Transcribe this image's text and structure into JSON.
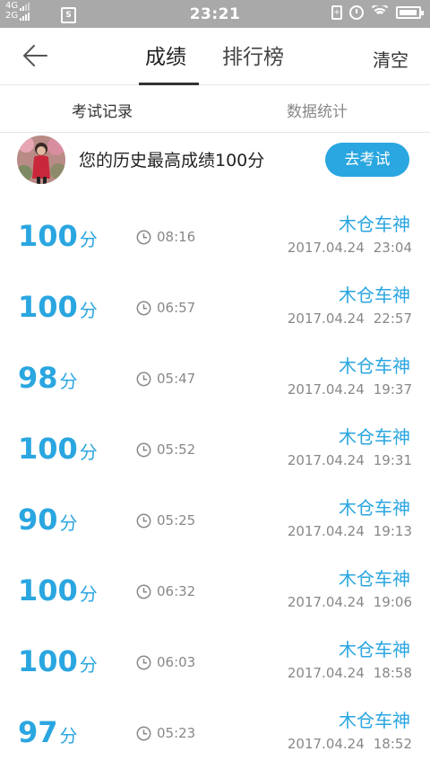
{
  "status_bar": {
    "net_top": "4G",
    "net_bottom": "2G",
    "sim_label": "S",
    "time": "23:21",
    "battery_level": 0.95
  },
  "header": {
    "tabs": [
      {
        "label": "成绩",
        "active": true
      },
      {
        "label": "排行榜",
        "active": false
      }
    ],
    "clear_label": "清空"
  },
  "sub_tabs": [
    {
      "label": "考试记录",
      "active": true
    },
    {
      "label": "数据统计",
      "active": false
    }
  ],
  "best": {
    "text": "您的历史最高成绩100分",
    "button_label": "去考试"
  },
  "colors": {
    "accent": "#2aa6e0",
    "status_bar": "#a9a9a9"
  },
  "records": [
    {
      "score": "100",
      "unit": "分",
      "duration": "08:16",
      "user": "木仓车神",
      "date": "2017.04.24",
      "time": "23:04"
    },
    {
      "score": "100",
      "unit": "分",
      "duration": "06:57",
      "user": "木仓车神",
      "date": "2017.04.24",
      "time": "22:57"
    },
    {
      "score": "98",
      "unit": "分",
      "duration": "05:47",
      "user": "木仓车神",
      "date": "2017.04.24",
      "time": "19:37"
    },
    {
      "score": "100",
      "unit": "分",
      "duration": "05:52",
      "user": "木仓车神",
      "date": "2017.04.24",
      "time": "19:31"
    },
    {
      "score": "90",
      "unit": "分",
      "duration": "05:25",
      "user": "木仓车神",
      "date": "2017.04.24",
      "time": "19:13"
    },
    {
      "score": "100",
      "unit": "分",
      "duration": "06:32",
      "user": "木仓车神",
      "date": "2017.04.24",
      "time": "19:06"
    },
    {
      "score": "100",
      "unit": "分",
      "duration": "06:03",
      "user": "木仓车神",
      "date": "2017.04.24",
      "time": "18:58"
    },
    {
      "score": "97",
      "unit": "分",
      "duration": "05:23",
      "user": "木仓车神",
      "date": "2017.04.24",
      "time": "18:52"
    }
  ]
}
